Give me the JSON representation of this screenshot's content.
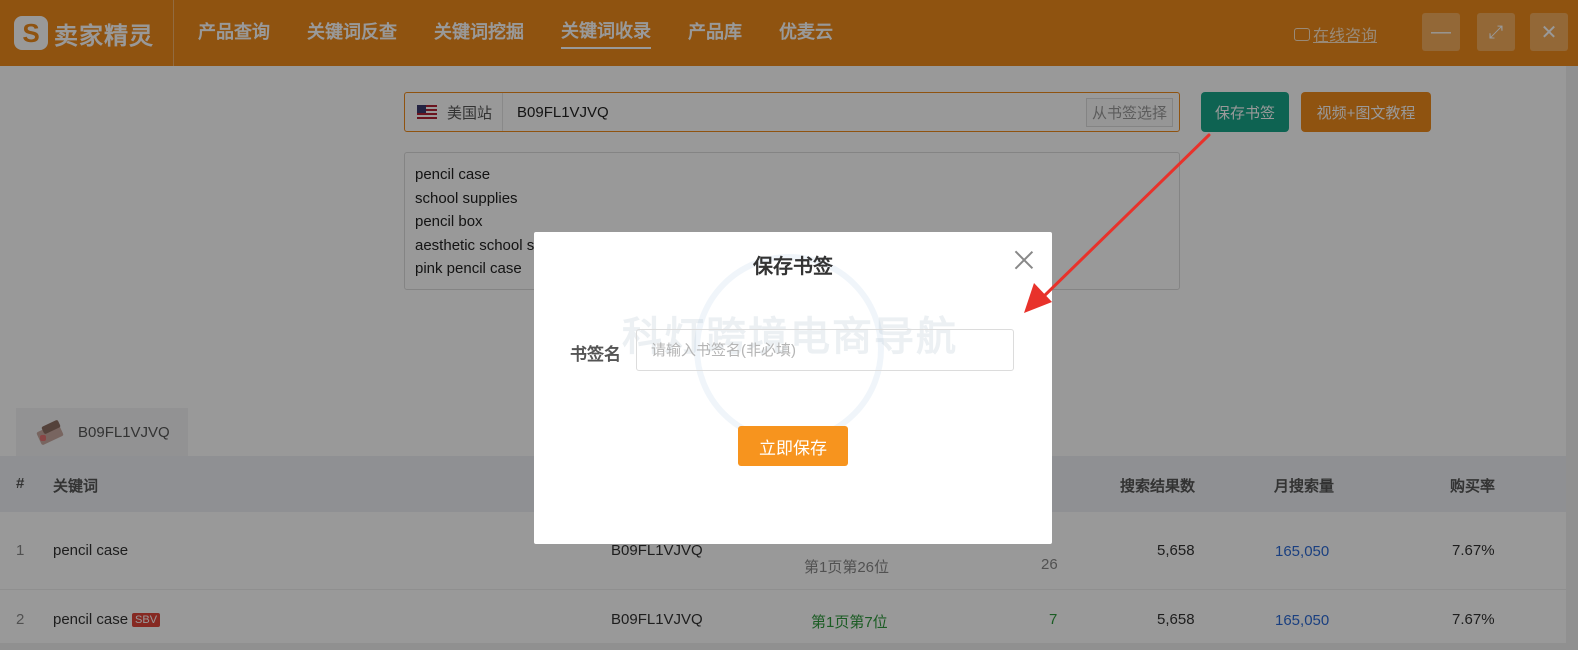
{
  "header": {
    "logo_mark": "S",
    "logo_text": "卖家精灵",
    "nav": [
      "产品查询",
      "关键词反查",
      "关键词挖掘",
      "关键词收录",
      "产品库",
      "优麦云"
    ],
    "active_nav_index": 3,
    "consult_label": "在线咨询",
    "window_controls": {
      "minimize": "—",
      "maximize": "⤢",
      "close": "✕"
    }
  },
  "search": {
    "site": "美国站",
    "value": "B09FL1VJVQ",
    "bookmark_pick_label": "从书签选择",
    "save_bookmark_label": "保存书签",
    "tutorial_label": "视频+图文教程"
  },
  "keywords_input": [
    "pencil case",
    "school supplies",
    "pencil box",
    "aesthetic school supplies",
    "pink pencil case"
  ],
  "product_tab": {
    "asin": "B09FL1VJVQ"
  },
  "table": {
    "headers": {
      "index": "#",
      "keyword": "关键词",
      "results": "搜索结果数",
      "monthly": "月搜索量",
      "purchase_rate": "购买率"
    },
    "rows": [
      {
        "index": "1",
        "keyword": "pencil case",
        "sbv": "",
        "asin": "B09FL1VJVQ",
        "rank": "第1页第26位",
        "position": "26",
        "results": "5,658",
        "monthly": "165,050",
        "purchase_rate": "7.67%"
      },
      {
        "index": "2",
        "keyword": "pencil case",
        "sbv": "SBV",
        "asin": "B09FL1VJVQ",
        "rank": "第1页第7位",
        "position": "7",
        "results": "5,658",
        "monthly": "165,050",
        "purchase_rate": "7.67%"
      }
    ]
  },
  "modal": {
    "title": "保存书签",
    "watermark": "科灯跨境电商导航",
    "field_label": "书签名",
    "field_placeholder": "请输入书签名(非必填)",
    "field_value": "",
    "submit_label": "立即保存"
  },
  "colors": {
    "brand": "#ef8a1c",
    "teal": "#18a689",
    "arrow": "#e8322b",
    "link": "#2d6bd6"
  }
}
